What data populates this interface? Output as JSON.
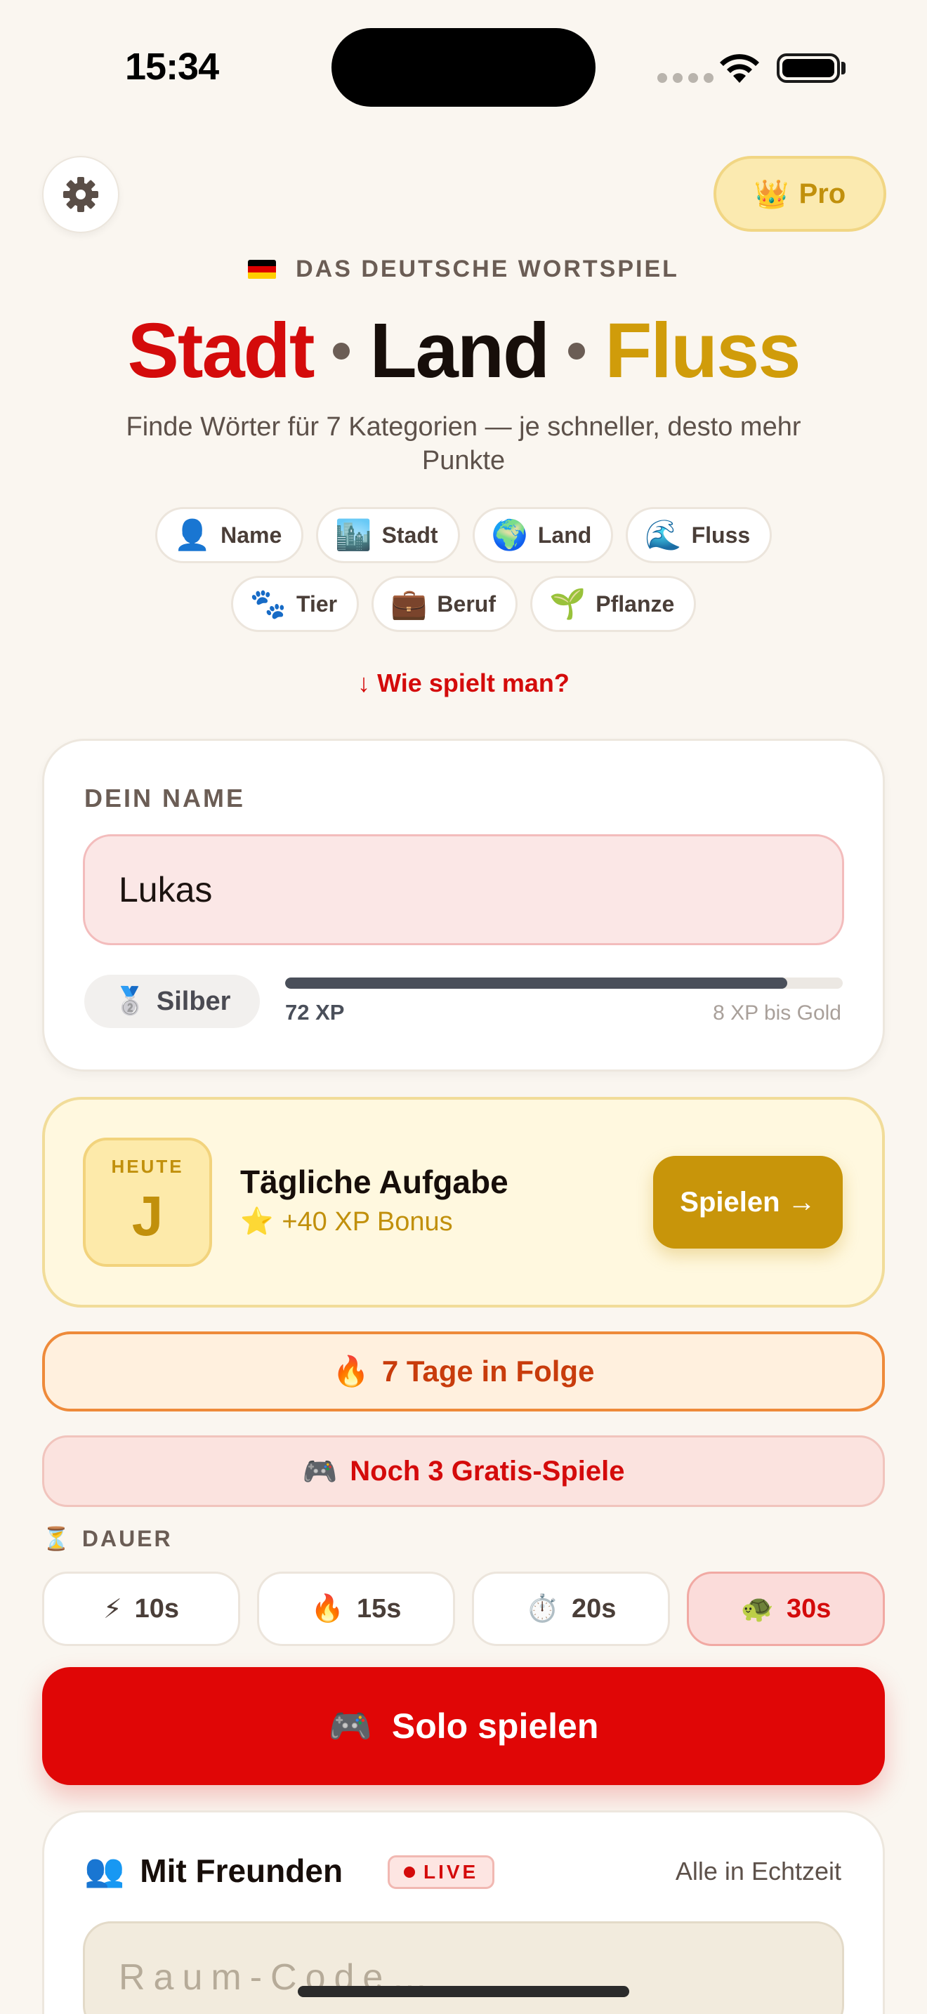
{
  "status_bar": {
    "time": "15:34"
  },
  "header": {
    "settings_icon": "gear-icon",
    "pro_label": "Pro",
    "pro_icon": "👑",
    "subtitle": "DAS DEUTSCHE WORTSPIEL",
    "flag_colors": [
      "#000000",
      "#dd0000",
      "#ffce00"
    ],
    "title": {
      "part1": "Stadt",
      "part2": "Land",
      "part3": "Fluss"
    },
    "tagline": "Finde Wörter für 7 Kategorien — je schneller, desto mehr Punkte"
  },
  "categories": [
    {
      "icon": "👤",
      "label": "Name"
    },
    {
      "icon": "🏙️",
      "label": "Stadt"
    },
    {
      "icon": "🌍",
      "label": "Land"
    },
    {
      "icon": "🌊",
      "label": "Fluss"
    },
    {
      "icon": "🐾",
      "label": "Tier"
    },
    {
      "icon": "💼",
      "label": "Beruf"
    },
    {
      "icon": "🌱",
      "label": "Pflanze"
    }
  ],
  "how_to": "↓ Wie spielt man?",
  "profile": {
    "label": "DEIN NAME",
    "name_value": "Lukas",
    "rank_icon": "🥈",
    "rank": "Silber",
    "xp_text": "72 XP",
    "xp_progress": 0.9,
    "next_rank": "8 XP bis Gold"
  },
  "daily": {
    "today_label": "HEUTE",
    "letter": "J",
    "title": "Tägliche Aufgabe",
    "bonus_icon": "⭐",
    "bonus": "+40 XP Bonus",
    "button": "Spielen →"
  },
  "streak": {
    "icon": "🔥",
    "text": "7 Tage in Folge"
  },
  "free_games": {
    "icon": "🎮",
    "text": "Noch 3 Gratis-Spiele"
  },
  "duration": {
    "icon": "⏳",
    "label": "DAUER",
    "options": [
      {
        "icon": "⚡",
        "label": "10s"
      },
      {
        "icon": "🔥",
        "label": "15s"
      },
      {
        "icon": "⏱️",
        "label": "20s"
      },
      {
        "icon": "🐢",
        "label": "30s"
      }
    ],
    "selected": "30s"
  },
  "solo": {
    "icon": "🎮",
    "label": "Solo spielen"
  },
  "friends": {
    "icon": "👥",
    "title": "Mit Freunden",
    "live": "LIVE",
    "realtime": "Alle in Echtzeit",
    "room_placeholder": "Raum-Code…"
  },
  "colors": {
    "red": "#d40b0b",
    "gold": "#d09c0a",
    "background": "#faf6f0"
  }
}
